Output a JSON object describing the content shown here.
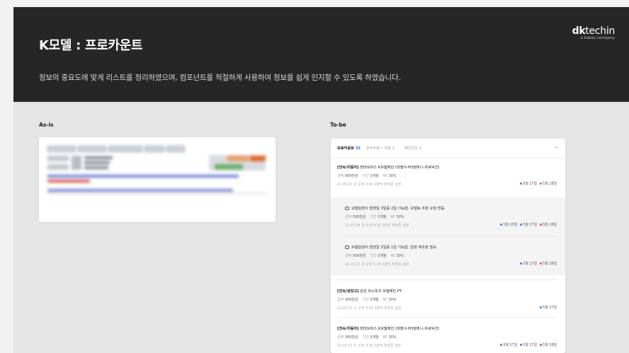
{
  "header": {
    "title": "K모델 : 프로카운트",
    "description": "정보의 중요도에 맞게 리스트를 정리하였으며, 컴포넌트를 적절하게 사용하여 정보를 쉽게 인지할 수 있도록 하였습니다.",
    "logo_bold": "dk",
    "logo_light": "techin",
    "logo_sub": "a kakao company"
  },
  "labels": {
    "asis": "As-is",
    "tobe": "To-be"
  },
  "tobe": {
    "tabs": [
      {
        "label": "프로카운트",
        "count": "33"
      },
      {
        "label": "본부수령 • 미정 2"
      },
      {
        "label": "예이콘도 1"
      }
    ],
    "items": [
      {
        "category": "[전속/자동차]",
        "title": "현대모비스 K모델제안 (대행사-PD컴퍼니-프로덕션)",
        "amount_label": "금액",
        "amount": "600만원",
        "period_label": "기간",
        "period": "3개월",
        "af_label": "AF",
        "af": "30%",
        "date": "22.05.01 수 오후 3:00  3분부 최현준 실장",
        "dates": [
          "5월 27일",
          "5월 28일"
        ]
      },
      {
        "category": "[전속/냉장고]",
        "title": "삼성 비스포크 모델제안 PT",
        "amount_label": "금액",
        "amount": "300만원",
        "period_label": "기간",
        "period": "3개월",
        "af_label": "AF",
        "af": "30%",
        "date": "22.05.01 수 오후 3:00  3분부 최현준 실장",
        "dates": [
          "5월 27일"
        ]
      },
      {
        "category": "[전속/자동차]",
        "title": "현대모비스 K모델제안 (대행사-PD컴퍼니-프로덕션)",
        "amount_label": "금액",
        "amount": "300만원",
        "period_label": "기간",
        "period": "3개월",
        "af_label": "AF",
        "af": "30%",
        "date": "22.05.01 수 오후 3:00  3분부 최현준 실장",
        "dates": [
          "5월 27일",
          "5월 27일",
          "5월 28일"
        ]
      }
    ],
    "sub_items": [
      {
        "title": "모델일정이 촬영일 3일중 2일 가능함. 모델료 조정 요청 받음.",
        "amount_label": "금액",
        "amount": "500만원",
        "period_label": "기간",
        "period": "3개월",
        "af_label": "AF",
        "af": "30%",
        "date": "22.01.04 목 오전 8:30  3분부 최현준 실장",
        "dates": [
          "5월 23일",
          "5월 27일",
          "5월 28일"
        ]
      },
      {
        "title": "모델일정이 촬영일 2일중 1일 가능함. 일정 재조정 필요.",
        "amount_label": "금액",
        "amount": "500만원",
        "period_label": "기간",
        "period": "3개월",
        "af_label": "AF",
        "af": "30%",
        "date": "22.10.11 금 오후 5:40  3분부 최현준 실장",
        "dates": [
          "5월 27일",
          "5월 28일"
        ]
      }
    ]
  },
  "colors": {
    "header_bg": "#262626",
    "accent_blue": "#3b7cf0",
    "accent_red": "#e84a3c"
  }
}
